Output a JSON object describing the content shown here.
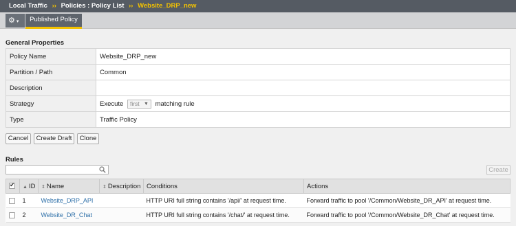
{
  "breadcrumb": {
    "items": [
      "Local Traffic",
      "Policies : Policy List",
      "Website_DRP_new"
    ],
    "separator": "››"
  },
  "toolbar": {
    "gear_icon": "⚙",
    "caret": "▾",
    "active_tab": "Published Policy"
  },
  "general": {
    "title": "General Properties",
    "rows": [
      {
        "label": "Policy Name",
        "value": "Website_DRP_new"
      },
      {
        "label": "Partition / Path",
        "value": "Common"
      },
      {
        "label": "Description",
        "value": ""
      },
      {
        "label": "Strategy",
        "prefix": "Execute",
        "select_value": "first",
        "suffix": "matching rule"
      },
      {
        "label": "Type",
        "value": "Traffic Policy"
      }
    ]
  },
  "actions": {
    "cancel": "Cancel",
    "create_draft": "Create Draft",
    "clone": "Clone"
  },
  "rules": {
    "title": "Rules",
    "search_placeholder": "",
    "create_label": "Create",
    "columns": [
      "ID",
      "Name",
      "Description",
      "Conditions",
      "Actions"
    ],
    "rows": [
      {
        "id": "1",
        "name": "Website_DRP_API",
        "description": "",
        "conditions": "HTTP URI full string contains '/api/' at request time.",
        "actions": "Forward traffic to pool '/Common/Website_DR_API' at request time."
      },
      {
        "id": "2",
        "name": "Website_DR_Chat",
        "description": "",
        "conditions": "HTTP URI full string contains '/chat/' at request time.",
        "actions": "Forward traffic to pool '/Common/Website_DR_Chat' at request time."
      }
    ]
  },
  "colors": {
    "accent": "#f3c200",
    "header_bg": "#555b63",
    "link": "#2d6fa8"
  }
}
